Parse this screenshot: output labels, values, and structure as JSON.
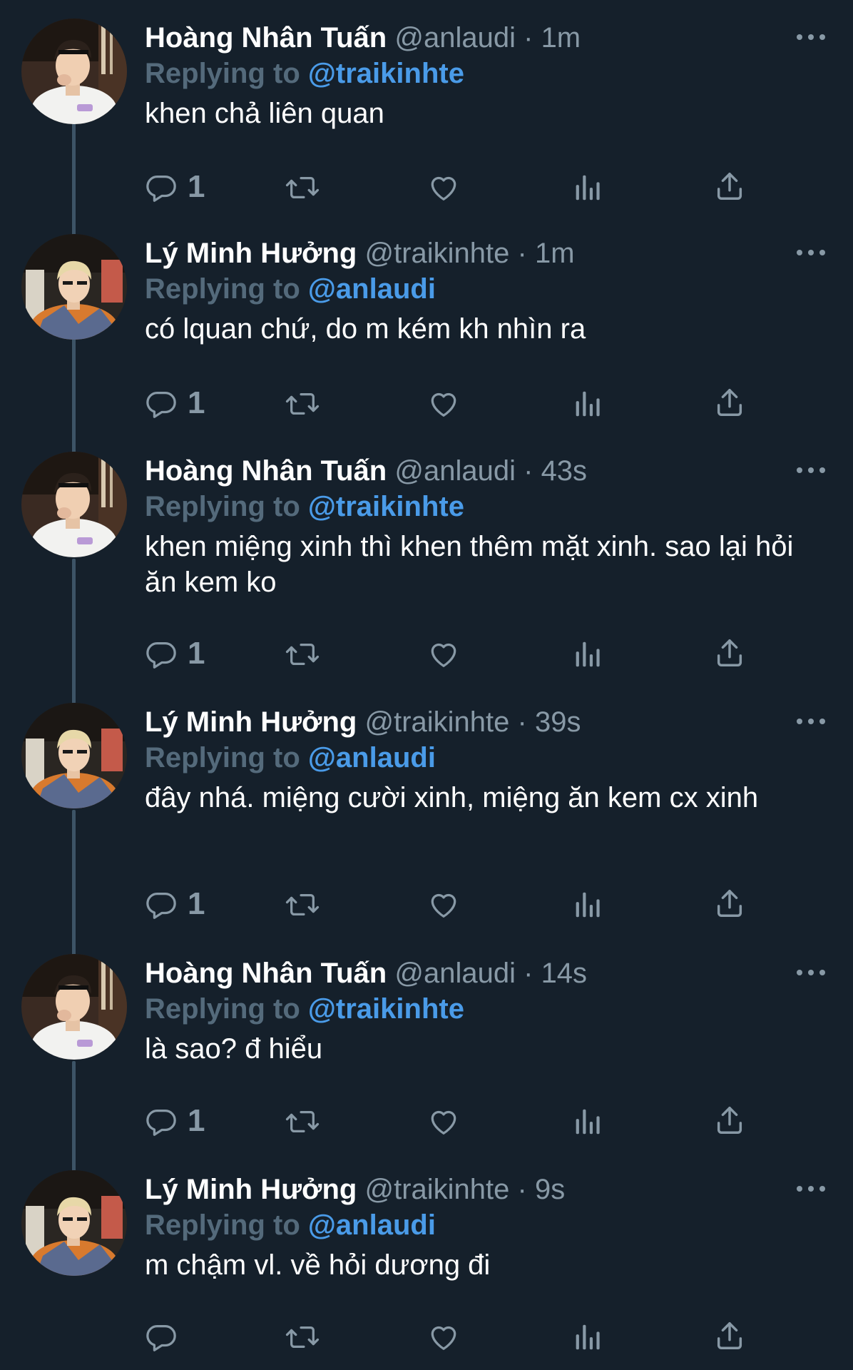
{
  "colors": {
    "background": "#15202b",
    "name": "#ffffff",
    "muted": "#8899a6",
    "reply_prefix": "#546a7b",
    "mention": "#4a9be8",
    "thread_line": "#3d5466"
  },
  "icons": {
    "reply": "reply-icon",
    "retweet": "retweet-icon",
    "like": "heart-icon",
    "stats": "bar-chart-icon",
    "share": "share-icon",
    "more": "more-options-icon"
  },
  "tweets": [
    {
      "author_name": "Hoàng Nhân Tuấn",
      "handle": "@anlaudi",
      "separator": "·",
      "time": "1m",
      "reply_prefix": "Replying to",
      "reply_to": "@traikinhte",
      "text": "khen chả liên quan",
      "reply_count": "1"
    },
    {
      "author_name": "Lý Minh Hưởng",
      "handle": "@traikinhte",
      "separator": "·",
      "time": "1m",
      "reply_prefix": "Replying to",
      "reply_to": "@anlaudi",
      "text": "có lquan chứ, do m kém kh nhìn ra",
      "reply_count": "1"
    },
    {
      "author_name": "Hoàng Nhân Tuấn",
      "handle": "@anlaudi",
      "separator": "·",
      "time": "43s",
      "reply_prefix": "Replying to",
      "reply_to": "@traikinhte",
      "text": "khen miệng xinh thì khen thêm mặt xinh. sao lại hỏi ăn kem ko",
      "reply_count": "1"
    },
    {
      "author_name": "Lý Minh Hưởng",
      "handle": "@traikinhte",
      "separator": "·",
      "time": "39s",
      "reply_prefix": "Replying to",
      "reply_to": "@anlaudi",
      "text": "đây nhá. miệng cười xinh, miệng ăn kem cx xinh",
      "reply_count": "1"
    },
    {
      "author_name": "Hoàng Nhân Tuấn",
      "handle": "@anlaudi",
      "separator": "·",
      "time": "14s",
      "reply_prefix": "Replying to",
      "reply_to": "@traikinhte",
      "text": "là sao? đ hiểu",
      "reply_count": "1"
    },
    {
      "author_name": "Lý Minh Hưởng",
      "handle": "@traikinhte",
      "separator": "·",
      "time": "9s",
      "reply_prefix": "Replying to",
      "reply_to": "@anlaudi",
      "text": "m chậm vl. về hỏi dương đi",
      "reply_count": ""
    }
  ]
}
